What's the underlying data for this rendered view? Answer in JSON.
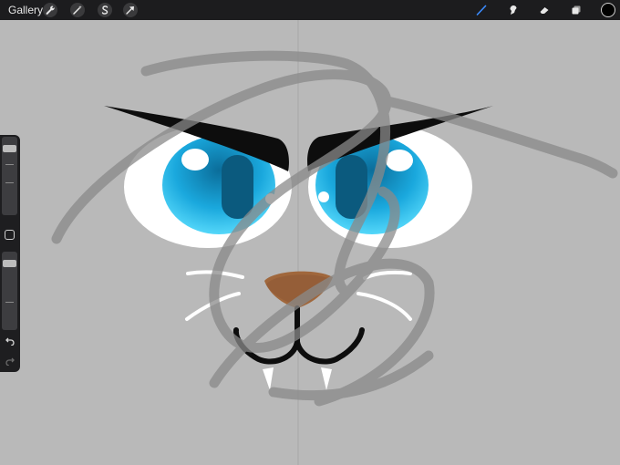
{
  "topbar": {
    "gallery_label": "Gallery",
    "left_tools": [
      "wrench-icon",
      "magic-wand-icon",
      "selection-icon",
      "move-arrow-icon"
    ],
    "right_tools": [
      "brush-icon",
      "smudge-icon",
      "eraser-icon",
      "layers-icon"
    ],
    "active_tool": "brush-icon",
    "active_tool_color": "#3b8cff",
    "current_color": "#000000"
  },
  "sidebar": {
    "brush_size": 0.9,
    "opacity": 0.9,
    "icons": [
      "modifier-square-icon",
      "undo-icon",
      "redo-icon"
    ]
  },
  "canvas": {
    "background_color": "#b9b9b9",
    "artwork": "cat-face-illustration",
    "colors": {
      "brow": "#0d0d0d",
      "eye_white": "#ffffff",
      "iris": "#1fb6e8",
      "nose": "#a0673c",
      "sketch": "#8a8a8a"
    }
  }
}
